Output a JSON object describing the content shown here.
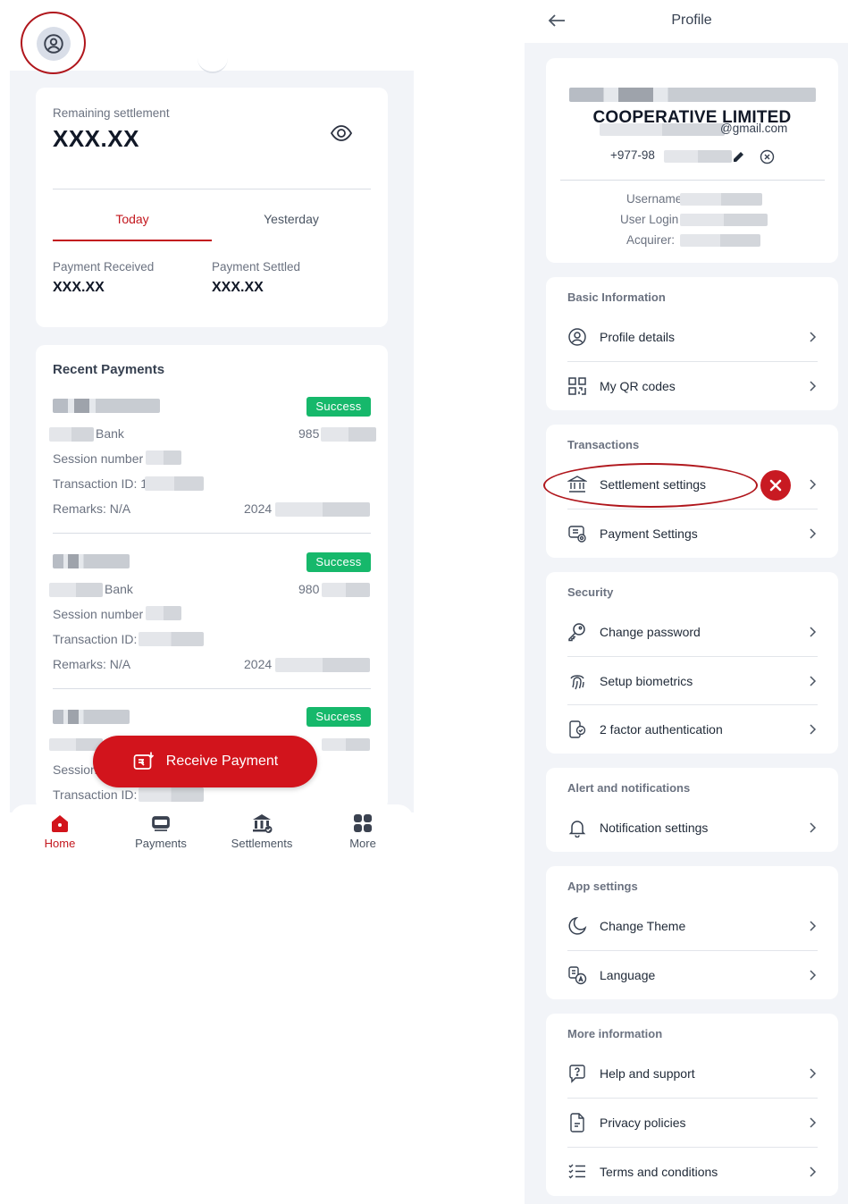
{
  "left": {
    "settlement": {
      "label": "Remaining settlement",
      "value": "XXX.XX",
      "tabs": [
        "Today",
        "Yesterday"
      ],
      "active_tab": "Today",
      "received_label": "Payment Received",
      "received_value": "XXX.XX",
      "settled_label": "Payment Settled",
      "settled_value": "XXX.XX"
    },
    "recent": {
      "title": "Recent Payments",
      "items": [
        {
          "status": "Success",
          "bank": "Bank",
          "amount": "985",
          "session": "Session number",
          "txn": "Transaction ID: 1",
          "remarks": "Remarks: N/A",
          "date": "2024"
        },
        {
          "status": "Success",
          "bank": "Bank",
          "amount": "980",
          "session": "Session number",
          "txn": "Transaction ID:",
          "remarks": "Remarks: N/A",
          "date": "2024"
        },
        {
          "status": "Success",
          "bank": "",
          "amount": "",
          "session": "Session",
          "txn": "Transaction ID:",
          "remarks": "",
          "date": ""
        }
      ]
    },
    "fab_label": "Receive Payment",
    "nav": [
      "Home",
      "Payments",
      "Settlements",
      "More"
    ],
    "nav_active": "Home",
    "accent": "#c3171e",
    "success_color": "#16b86b"
  },
  "right": {
    "title": "Profile",
    "account": {
      "name": "COOPERATIVE LIMITED",
      "email": "@gmail.com",
      "phone": "+977-98",
      "username_label": "Username",
      "user_login_label": "User Login",
      "acquirer_label": "Acquirer:"
    },
    "sections": [
      {
        "title": "Basic Information",
        "items": [
          "Profile details",
          "My QR codes"
        ]
      },
      {
        "title": "Transactions",
        "items": [
          "Settlement settings",
          "Payment Settings"
        ]
      },
      {
        "title": "Security",
        "items": [
          "Change password",
          "Setup biometrics",
          "2 factor authentication"
        ]
      },
      {
        "title": "Alert and notifications",
        "items": [
          "Notification settings"
        ]
      },
      {
        "title": "App settings",
        "items": [
          "Change Theme",
          "Language"
        ]
      },
      {
        "title": "More information",
        "items": [
          "Help and support",
          "Privacy policies",
          "Terms and conditions"
        ]
      }
    ]
  }
}
